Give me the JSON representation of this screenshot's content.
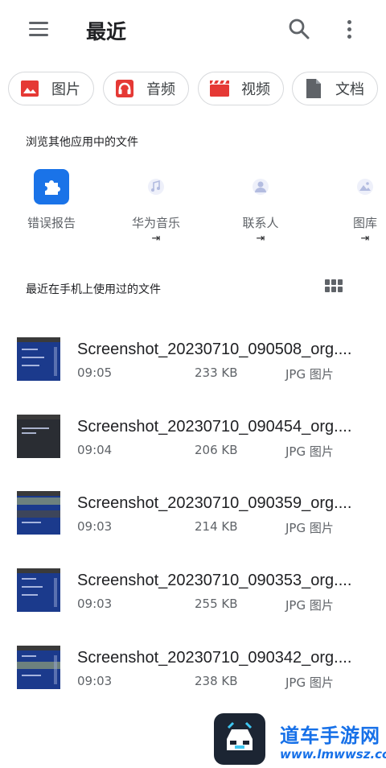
{
  "header": {
    "title": "最近",
    "menu_icon": "menu-icon",
    "search_icon": "search-icon",
    "more_icon": "more-vert-icon"
  },
  "categories": [
    {
      "label": "图片",
      "icon": "image-icon",
      "color": "#e53935"
    },
    {
      "label": "音频",
      "icon": "headphones-icon",
      "color": "#e53935"
    },
    {
      "label": "视频",
      "icon": "movie-icon",
      "color": "#e53935"
    },
    {
      "label": "文档",
      "icon": "document-icon",
      "color": "#5f6368"
    }
  ],
  "other_apps": {
    "title": "浏览其他应用中的文件",
    "items": [
      {
        "label": "错误报告",
        "sub": "",
        "icon": "puzzle-icon",
        "color": "#1a73e8"
      },
      {
        "label": "华为音乐",
        "sub": "⇥",
        "icon": "music-app-icon",
        "color": "#c5cae9"
      },
      {
        "label": "联系人",
        "sub": "⇥",
        "icon": "contacts-app-icon",
        "color": "#c5cae9"
      },
      {
        "label": "图库",
        "sub": "⇥",
        "icon": "gallery-app-icon",
        "color": "#c5cae9"
      }
    ]
  },
  "recent": {
    "title": "最近在手机上使用过的文件",
    "grid_icon": "grid-view-icon",
    "files": [
      {
        "name": "Screenshot_20230710_090508_org....",
        "time": "09:05",
        "size": "233 KB",
        "type": "JPG 图片"
      },
      {
        "name": "Screenshot_20230710_090454_org....",
        "time": "09:04",
        "size": "206 KB",
        "type": "JPG 图片"
      },
      {
        "name": "Screenshot_20230710_090359_org....",
        "time": "09:03",
        "size": "214 KB",
        "type": "JPG 图片"
      },
      {
        "name": "Screenshot_20230710_090353_org....",
        "time": "09:03",
        "size": "255 KB",
        "type": "JPG 图片"
      },
      {
        "name": "Screenshot_20230710_090342_org....",
        "time": "09:03",
        "size": "238 KB",
        "type": "JPG 图片"
      }
    ]
  },
  "watermark": {
    "title": "道车手游网",
    "url": "www.lmwwsz.com"
  },
  "colors": {
    "accent": "#1a73e8",
    "chip_red": "#e53935",
    "text_secondary": "#5f6368"
  }
}
